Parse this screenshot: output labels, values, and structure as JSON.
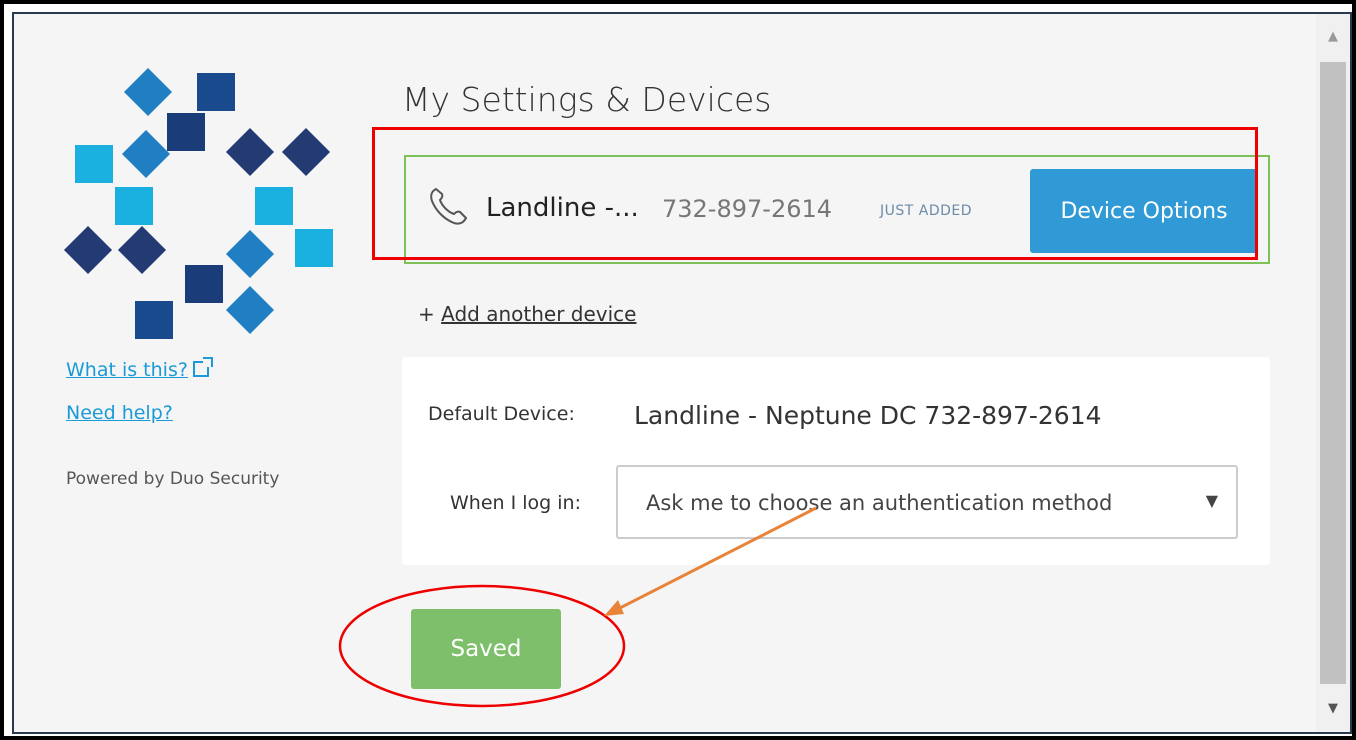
{
  "sidebar": {
    "what_is_this": "What is this?",
    "need_help": "Need help?",
    "powered_by": "Powered by Duo Security"
  },
  "main": {
    "title": "My Settings & Devices",
    "device": {
      "name": "Landline -...",
      "number": "732-897-2614",
      "status": "JUST ADDED",
      "options_label": "Device Options"
    },
    "add_device_prefix": "+",
    "add_device_label": "Add another device",
    "default_device_label": "Default Device:",
    "default_device_value": "Landline - Neptune DC 732-897-2614",
    "when_login_label": "When I log in:",
    "when_login_value": "Ask me to choose an authentication method",
    "saved_label": "Saved"
  },
  "colors": {
    "accent_blue": "#2f9ad6",
    "saved_green": "#7dbf6a",
    "device_border_green": "#7ec05a",
    "annotation_red": "#e00000",
    "annotation_orange": "#e8843a"
  },
  "icons": {
    "phone": "phone-icon",
    "external_link": "external-link-icon",
    "caret": "caret-down-icon"
  }
}
